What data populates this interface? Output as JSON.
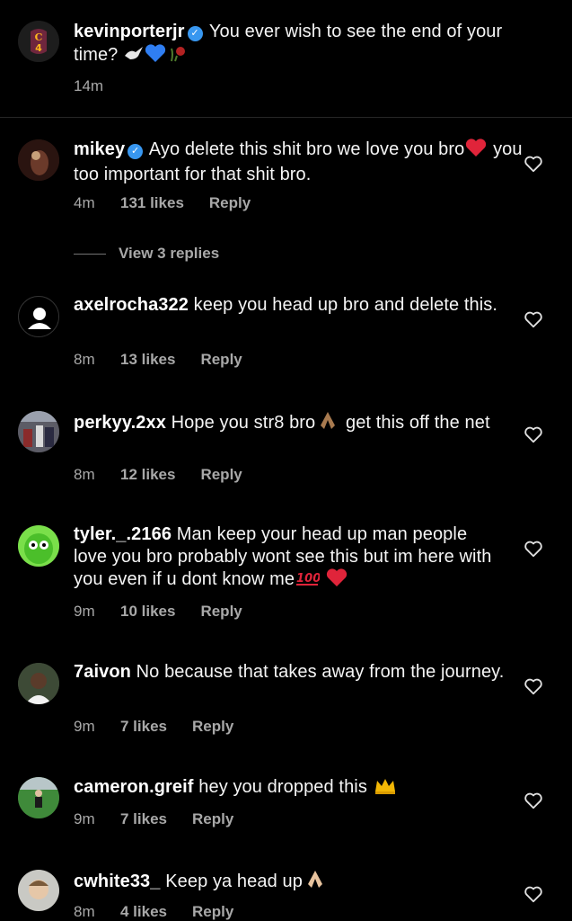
{
  "caption": {
    "username": "kevinporterjr",
    "text": "You ever wish to see the end of your time?",
    "time": "14m"
  },
  "comments": [
    {
      "username": "mikey",
      "verified": true,
      "text": "Ayo delete this shit bro we love you bro",
      "text2": "you too important for that shit bro.",
      "time": "4m",
      "likes": "131 likes",
      "reply": "Reply"
    },
    {
      "username": "axelrocha322",
      "text": "keep you head up bro and delete this.",
      "time": "8m",
      "likes": "13 likes",
      "reply": "Reply"
    },
    {
      "username": "perkyy.2xx",
      "text": "Hope you str8 bro",
      "text2": "get this off the net",
      "time": "8m",
      "likes": "12 likes",
      "reply": "Reply"
    },
    {
      "username": "tyler._.2166",
      "text": "Man keep your head up man people love you bro probably wont see this but im here with you even if u dont know me",
      "time": "9m",
      "likes": "10 likes",
      "reply": "Reply"
    },
    {
      "username": "7aivon",
      "text": "No because that takes away from the journey.",
      "time": "9m",
      "likes": "7 likes",
      "reply": "Reply"
    },
    {
      "username": "cameron.greif",
      "text": "hey you dropped this",
      "time": "9m",
      "likes": "7 likes",
      "reply": "Reply"
    },
    {
      "username": "cwhite33_",
      "text": "Keep ya head up",
      "time": "8m",
      "likes": "4 likes",
      "reply": "Reply"
    }
  ],
  "view_replies": "View 3 replies",
  "icons": {
    "heart": "heart-outline-icon",
    "verified": "verified-badge-icon"
  },
  "colors": {
    "background": "#000000",
    "meta": "#a8a8a8",
    "verified": "#3897f0",
    "divider": "#262626"
  }
}
